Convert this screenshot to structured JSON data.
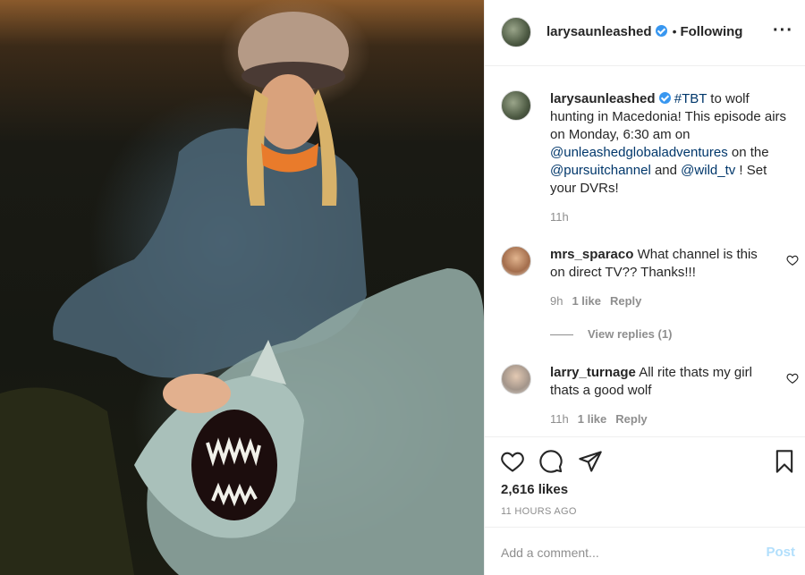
{
  "post": {
    "username": "larysaunleashed",
    "follow_status": "Following",
    "more_icon": "more-horizontal-icon",
    "caption": {
      "username": "larysaunleashed",
      "parts": [
        {
          "text": "#TBT",
          "link": true
        },
        {
          "text": " to wolf hunting in Macedonia! This episode airs on Monday, 6:30 am on ",
          "link": false
        },
        {
          "text": "@unleashedglobaladventures",
          "link": true
        },
        {
          "text": " on the ",
          "link": false
        },
        {
          "text": "@pursuitchannel",
          "link": true
        },
        {
          "text": " and ",
          "link": false
        },
        {
          "text": "@wild_tv",
          "link": true
        },
        {
          "text": " ! Set your DVRs!",
          "link": false
        }
      ],
      "time": "11h"
    },
    "comments": [
      {
        "username": "mrs_sparaco",
        "text": "What channel is this on direct TV?? Thanks!!!",
        "time": "9h",
        "likes": "1 like",
        "reply": "Reply"
      },
      {
        "username": "larry_turnage",
        "text": "All rite thats my girl thats a good wolf",
        "time": "11h",
        "likes": "1 like",
        "reply": "Reply"
      }
    ],
    "view_replies": "View replies (1)",
    "likes_count": "2,616 likes",
    "posted_ago": "11 HOURS AGO",
    "add_comment_placeholder": "Add a comment...",
    "post_label": "Post",
    "colors": {
      "verified": "#3897f0",
      "link": "#00376b",
      "post_disabled": "#b2dffc",
      "muted": "#8e8e8e"
    }
  }
}
